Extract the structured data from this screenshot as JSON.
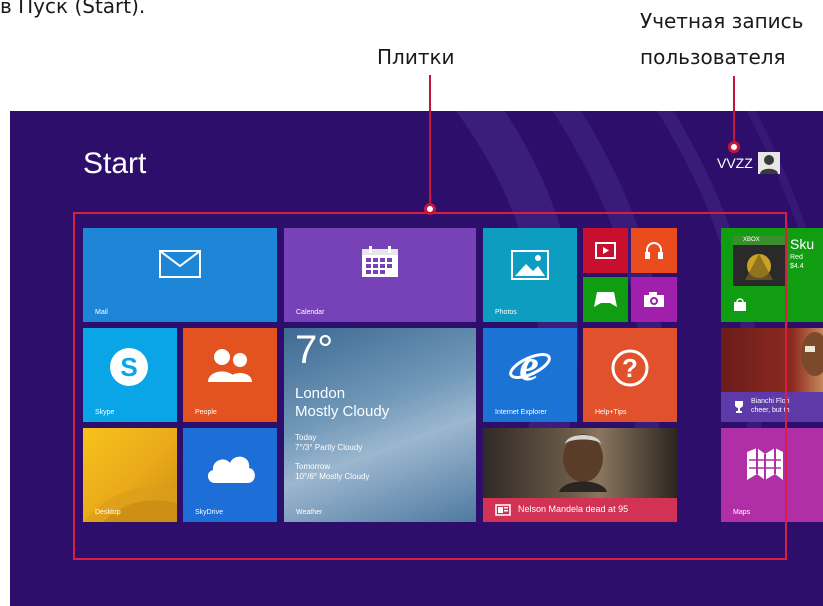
{
  "annotations": {
    "top_left": "в Пуск (Start).",
    "tiles_label": "Плитки",
    "account_label_line1": "Учетная запись",
    "account_label_line2": "пользователя"
  },
  "start": {
    "title": "Start",
    "user_name": "VVZZ"
  },
  "tiles": {
    "mail": "Mail",
    "calendar": "Calendar",
    "photos": "Photos",
    "skype": "Skype",
    "people": "People",
    "internet_explorer": "Internet Explorer",
    "help_tips": "Help+Tips",
    "desktop": "Desktop",
    "skydrive": "SkyDrive",
    "maps": "Maps",
    "weather": {
      "label": "Weather",
      "temperature": "7°",
      "city": "London",
      "condition": "Mostly Cloudy",
      "today_label": "Today",
      "today_forecast": "7°/3° Partly Cloudy",
      "tomorrow_label": "Tomorrow",
      "tomorrow_forecast": "10°/6° Mostly Cloudy"
    },
    "news": {
      "headline": "Nelson Mandela dead at 95"
    },
    "store": {
      "app_name": "Sku",
      "line2": "Red",
      "price": "$4.4",
      "badge": "XBOX"
    },
    "sport": {
      "line1": "Bianchi Flori",
      "line2": "cheer, but th"
    }
  },
  "colors": {
    "background": "#2d0f6b",
    "frame": "#d81e44",
    "mail": "#1d86d7",
    "calendar": "#7741b7",
    "photos": "#0c9dc0",
    "skype": "#0aa5e6",
    "people": "#e2531f",
    "internet_explorer": "#1b73d6",
    "help_tips": "#e1512b",
    "skydrive": "#1d6fd7",
    "maps": "#b12fa6"
  }
}
